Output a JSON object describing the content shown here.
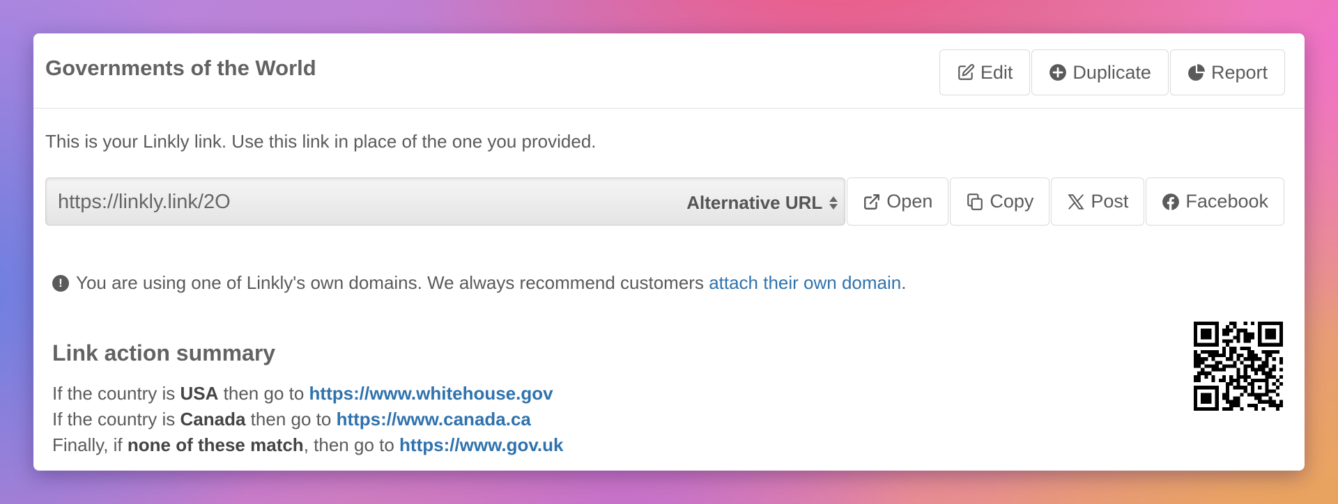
{
  "card": {
    "title": "Governments of the World",
    "actions": {
      "edit": "Edit",
      "duplicate": "Duplicate",
      "report": "Report"
    }
  },
  "intro": "This is your Linkly link. Use this link in place of the one you provided.",
  "url_field": {
    "value": "https://linkly.link/2O",
    "select_value": "Alternative URL"
  },
  "url_actions": {
    "open": "Open",
    "copy": "Copy",
    "post": "Post",
    "facebook": "Facebook"
  },
  "notice": {
    "text_before": "You are using one of Linkly's own domains. We always recommend customers ",
    "link_text": "attach their own domain",
    "text_after": "."
  },
  "summary": {
    "title": "Link action summary",
    "rules": [
      {
        "prefix": "If the country is ",
        "condition": "USA",
        "middle": " then go to ",
        "url": "https://www.whitehouse.gov"
      },
      {
        "prefix": "If the country is ",
        "condition": "Canada",
        "middle": " then go to ",
        "url": "https://www.canada.ca"
      },
      {
        "prefix": "Finally, if ",
        "condition": "none of these match",
        "middle": ", then go to ",
        "url": "https://www.gov.uk"
      }
    ]
  },
  "colors": {
    "link": "#2f72ad",
    "text": "#5a5a5a",
    "title": "#626262"
  },
  "icons": {
    "edit": "edit-icon",
    "duplicate": "plus-circle-icon",
    "report": "pie-chart-icon",
    "open": "external-link-icon",
    "copy": "copy-icon",
    "post": "x-logo-icon",
    "facebook": "facebook-icon",
    "notice": "exclamation-circle-icon",
    "qr": "qr-code-icon"
  }
}
